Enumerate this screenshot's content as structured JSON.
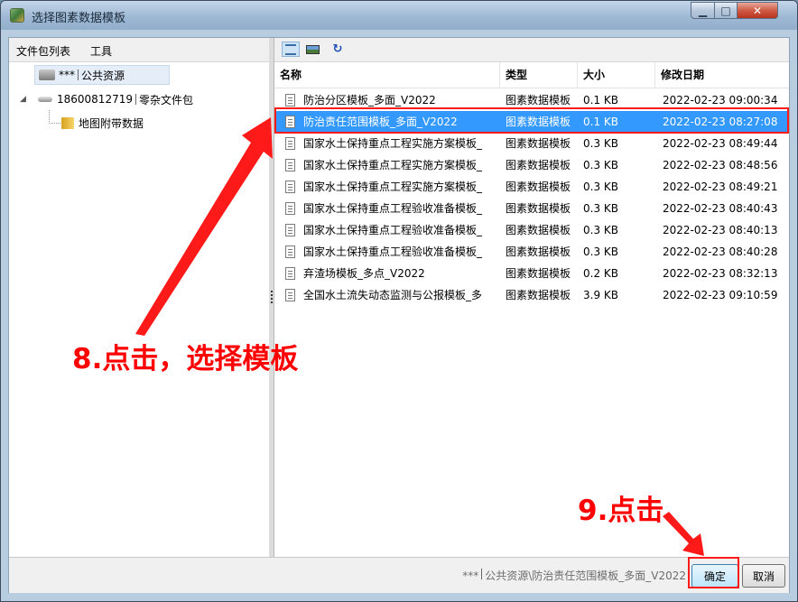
{
  "window": {
    "title": "选择图素数据模板",
    "min_glyph": "▁",
    "max_glyph": "□",
    "close_glyph": "✕"
  },
  "left_panel": {
    "menu": [
      "文件包列表",
      "工具"
    ],
    "tree": [
      {
        "prefix": "***",
        "label": "公共资源",
        "icon": "public-server-icon"
      },
      {
        "prefix": "18600812719",
        "label": "零杂文件包",
        "icon": "drive-icon"
      },
      {
        "label": "地图附带数据",
        "icon": "folder-icon"
      }
    ]
  },
  "right_panel": {
    "toolbar": {
      "refresh_glyph": "↻"
    },
    "columns": [
      "名称",
      "类型",
      "大小",
      "修改日期"
    ],
    "files": [
      {
        "name": "防治分区模板_多面_V2022",
        "type": "图素数据模板",
        "size": "0.1 KB",
        "modified": "2022-02-23 09:00:34"
      },
      {
        "name": "防治责任范围模板_多面_V2022",
        "type": "图素数据模板",
        "size": "0.1 KB",
        "modified": "2022-02-23 08:27:08"
      },
      {
        "name": "国家水土保持重点工程实施方案模板_",
        "type": "图素数据模板",
        "size": "0.3 KB",
        "modified": "2022-02-23 08:49:44"
      },
      {
        "name": "国家水土保持重点工程实施方案模板_",
        "type": "图素数据模板",
        "size": "0.3 KB",
        "modified": "2022-02-23 08:48:56"
      },
      {
        "name": "国家水土保持重点工程实施方案模板_",
        "type": "图素数据模板",
        "size": "0.3 KB",
        "modified": "2022-02-23 08:49:21"
      },
      {
        "name": "国家水土保持重点工程验收准备模板_",
        "type": "图素数据模板",
        "size": "0.3 KB",
        "modified": "2022-02-23 08:40:43"
      },
      {
        "name": "国家水土保持重点工程验收准备模板_",
        "type": "图素数据模板",
        "size": "0.3 KB",
        "modified": "2022-02-23 08:40:13"
      },
      {
        "name": "国家水土保持重点工程验收准备模板_",
        "type": "图素数据模板",
        "size": "0.3 KB",
        "modified": "2022-02-23 08:40:28"
      },
      {
        "name": "弃渣场模板_多点_V2022",
        "type": "图素数据模板",
        "size": "0.2 KB",
        "modified": "2022-02-23 08:32:13"
      },
      {
        "name": "全国水土流失动态监测与公报模板_多",
        "type": "图素数据模板",
        "size": "3.9 KB",
        "modified": "2022-02-23 09:10:59"
      }
    ],
    "selected_index": 1
  },
  "status_bar": {
    "path_prefix": "***",
    "path": "公共资源\\防治责任范围模板_多面_V2022",
    "ok_label": "确定",
    "cancel_label": "取消"
  },
  "annotations": {
    "step8": "8.点击，选择模板",
    "step9": "9.点击",
    "color": "#ff0000"
  },
  "colors": {
    "selection": "#3399ff"
  }
}
